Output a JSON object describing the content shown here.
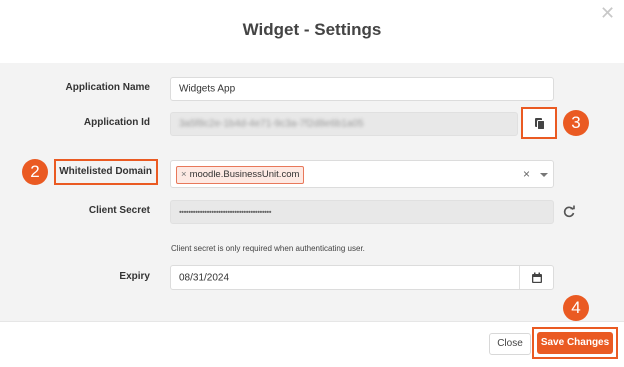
{
  "dialog": {
    "title": "Widget - Settings",
    "close_icon": "close-icon"
  },
  "form": {
    "application_name": {
      "label": "Application Name",
      "value": "Widgets App"
    },
    "application_id": {
      "label": "Application Id",
      "value": "3a5f8c2e-1b4d-4e71-9c3a-7f2d8e6b1a05",
      "copy_icon": "copy-icon"
    },
    "whitelisted_domain": {
      "label": "Whitelisted Domain",
      "tags": [
        "moodle.BusinessUnit.com"
      ],
      "tag_remove": "×",
      "clear": "×",
      "dropdown_icon": "chevron-down-icon"
    },
    "client_secret": {
      "label": "Client Secret",
      "value": "••••••••••••••••••••••••••••••••••••••••",
      "refresh_icon": "refresh-icon",
      "hint": "Client secret is only required when authenticating user."
    },
    "expiry": {
      "label": "Expiry",
      "value": "08/31/2024",
      "calendar_icon": "calendar-icon"
    }
  },
  "annotations": [
    "2",
    "3",
    "4"
  ],
  "footer": {
    "close_label": "Close",
    "save_label": "Save Changes"
  },
  "colors": {
    "accent": "#ea5a22",
    "tag_bg": "#fde9e3",
    "body_bg": "#f3f3f3"
  }
}
